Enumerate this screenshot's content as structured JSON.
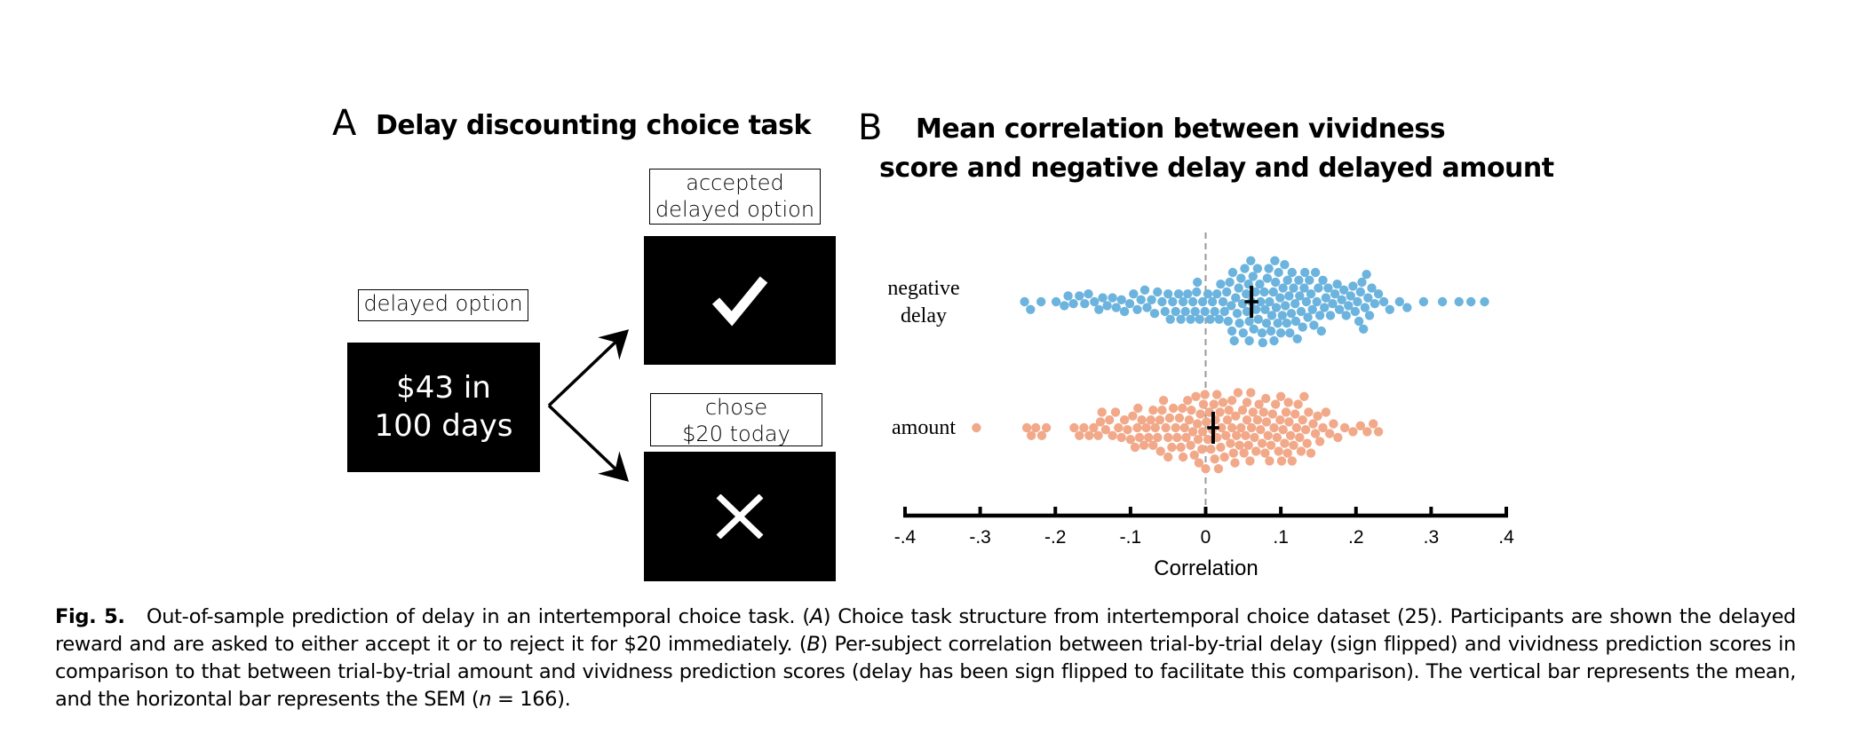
{
  "panel_a": {
    "letter": "A",
    "title": "Delay discounting choice task",
    "delayed_option_label": "delayed option",
    "stimulus_line1": "$43 in",
    "stimulus_line2": "100 days",
    "accepted_label_line1": "accepted",
    "accepted_label_line2": "delayed option",
    "accepted_icon": "checkmark-icon",
    "accepted_glyph": "✓",
    "rejected_label_line1": "chose",
    "rejected_label_line2": "$20 today",
    "rejected_icon": "x-icon",
    "rejected_glyph": "X"
  },
  "panel_b": {
    "letter": "B",
    "title_line1": "Mean correlation between vividness",
    "title_line2": "score and negative delay and delayed amount"
  },
  "chart_data": {
    "type": "scatter",
    "subtype": "beeswarm",
    "title": "Mean correlation between vividness score and negative delay and delayed amount",
    "xlabel": "Correlation",
    "ylabel": "",
    "xlim": [
      -0.4,
      0.4
    ],
    "xticks": [
      -0.4,
      -0.3,
      -0.2,
      -0.1,
      0,
      0.1,
      0.2,
      0.3,
      0.4
    ],
    "xtick_labels": [
      "-.4",
      "-.3",
      "-.2",
      "-.1",
      "0",
      ".1",
      ".2",
      ".3",
      ".4"
    ],
    "reference_line": {
      "x": 0,
      "style": "dashed",
      "color": "#999999"
    },
    "grid": false,
    "legend": "none",
    "n": 166,
    "series": [
      {
        "name": "negative delay",
        "label_line1": "negative",
        "label_line2": "delay",
        "color": "#6cb4de",
        "mean": 0.061,
        "sem": 0.009,
        "values": [
          -0.241,
          -0.233,
          -0.219,
          -0.199,
          -0.188,
          -0.183,
          -0.176,
          -0.168,
          -0.161,
          -0.156,
          -0.148,
          -0.142,
          -0.137,
          -0.131,
          -0.124,
          -0.119,
          -0.112,
          -0.108,
          -0.101,
          -0.096,
          -0.091,
          -0.086,
          -0.081,
          -0.078,
          -0.072,
          -0.068,
          -0.064,
          -0.058,
          -0.054,
          -0.05,
          -0.047,
          -0.044,
          -0.04,
          -0.036,
          -0.033,
          -0.03,
          -0.027,
          -0.024,
          -0.02,
          -0.017,
          -0.014,
          -0.011,
          -0.008,
          -0.004,
          -0.001,
          0.003,
          0.006,
          0.009,
          0.012,
          0.015,
          0.018,
          0.02,
          0.023,
          0.025,
          0.028,
          0.03,
          0.032,
          0.034,
          0.036,
          0.038,
          0.04,
          0.042,
          0.044,
          0.045,
          0.047,
          0.049,
          0.05,
          0.052,
          0.054,
          0.055,
          0.057,
          0.058,
          0.06,
          0.061,
          0.063,
          0.064,
          0.066,
          0.067,
          0.069,
          0.07,
          0.072,
          0.073,
          0.075,
          0.076,
          0.078,
          0.079,
          0.081,
          0.082,
          0.084,
          0.085,
          0.087,
          0.088,
          0.09,
          0.091,
          0.093,
          0.094,
          0.096,
          0.097,
          0.099,
          0.1,
          0.102,
          0.103,
          0.105,
          0.106,
          0.108,
          0.109,
          0.111,
          0.112,
          0.114,
          0.115,
          0.117,
          0.119,
          0.12,
          0.122,
          0.124,
          0.125,
          0.127,
          0.129,
          0.131,
          0.132,
          0.134,
          0.136,
          0.138,
          0.14,
          0.142,
          0.144,
          0.146,
          0.148,
          0.15,
          0.152,
          0.154,
          0.156,
          0.158,
          0.16,
          0.163,
          0.166,
          0.169,
          0.172,
          0.175,
          0.178,
          0.181,
          0.184,
          0.187,
          0.19,
          0.193,
          0.196,
          0.199,
          0.202,
          0.204,
          0.206,
          0.208,
          0.21,
          0.212,
          0.214,
          0.216,
          0.218,
          0.221,
          0.225,
          0.23,
          0.237,
          0.245,
          0.258,
          0.268,
          0.29,
          0.315,
          0.337,
          0.353,
          0.371,
          -0.012,
          0.035,
          0.058,
          0.092
        ],
        "description": "Per-subject correlations between vividness score and negative delay"
      },
      {
        "name": "amount",
        "label_line1": "amount",
        "label_line2": "",
        "color": "#f2a98a",
        "mean": 0.01,
        "sem": 0.008,
        "values": [
          -0.305,
          -0.238,
          -0.232,
          -0.226,
          -0.218,
          -0.212,
          -0.175,
          -0.168,
          -0.162,
          -0.155,
          -0.149,
          -0.143,
          -0.138,
          -0.133,
          -0.128,
          -0.124,
          -0.12,
          -0.116,
          -0.112,
          -0.108,
          -0.104,
          -0.1,
          -0.097,
          -0.094,
          -0.091,
          -0.088,
          -0.085,
          -0.082,
          -0.079,
          -0.076,
          -0.073,
          -0.07,
          -0.067,
          -0.064,
          -0.061,
          -0.058,
          -0.056,
          -0.053,
          -0.05,
          -0.048,
          -0.045,
          -0.043,
          -0.04,
          -0.038,
          -0.035,
          -0.033,
          -0.031,
          -0.028,
          -0.026,
          -0.024,
          -0.022,
          -0.019,
          -0.017,
          -0.015,
          -0.013,
          -0.011,
          -0.009,
          -0.007,
          -0.005,
          -0.003,
          -0.001,
          0.001,
          0.003,
          0.005,
          0.007,
          0.009,
          0.011,
          0.013,
          0.015,
          0.017,
          0.019,
          0.021,
          0.023,
          0.025,
          0.027,
          0.029,
          0.031,
          0.033,
          0.035,
          0.037,
          0.039,
          0.041,
          0.043,
          0.045,
          0.047,
          0.049,
          0.051,
          0.053,
          0.055,
          0.057,
          0.059,
          0.061,
          0.063,
          0.065,
          0.067,
          0.069,
          0.071,
          0.073,
          0.075,
          0.077,
          0.079,
          0.081,
          0.083,
          0.085,
          0.087,
          0.089,
          0.091,
          0.093,
          0.095,
          0.097,
          0.099,
          0.101,
          0.103,
          0.105,
          0.107,
          0.109,
          0.111,
          0.113,
          0.115,
          0.117,
          0.119,
          0.121,
          0.123,
          0.125,
          0.127,
          0.129,
          0.131,
          0.133,
          0.135,
          0.137,
          0.14,
          0.143,
          0.146,
          0.149,
          0.152,
          0.156,
          0.16,
          0.165,
          0.17,
          0.176,
          0.185,
          0.196,
          0.206,
          0.215,
          0.223,
          0.23,
          -0.02,
          -0.06,
          -0.09,
          -0.14,
          0.0,
          0.02,
          0.04,
          0.06,
          0.08,
          0.1,
          -0.03,
          -0.05,
          0.015,
          0.035,
          0.055,
          -0.01,
          -0.07,
          0.11,
          0.012,
          -0.004
        ],
        "description": "Per-subject correlations between vividness score and delayed amount"
      }
    ]
  },
  "caption": {
    "fig_label": "Fig. 5.",
    "part1": "Out-of-sample prediction of delay in an intertemporal choice task. (",
    "a_letter": "A",
    "part2": ") Choice task structure from intertemporal choice dataset (25). Participants are shown the delayed reward and are asked to either accept it or to reject it for $20 immediately. (",
    "b_letter": "B",
    "part3": ") Per-subject correlation between trial-by-trial delay (sign flipped) and vividness prediction scores in comparison to that between trial-by-trial amount and vividness prediction scores (delay has been sign flipped to facilitate this comparison). The vertical bar represents the mean, and the horizontal bar represents the SEM (",
    "n_symbol": "n",
    "part4": " = 166)."
  }
}
